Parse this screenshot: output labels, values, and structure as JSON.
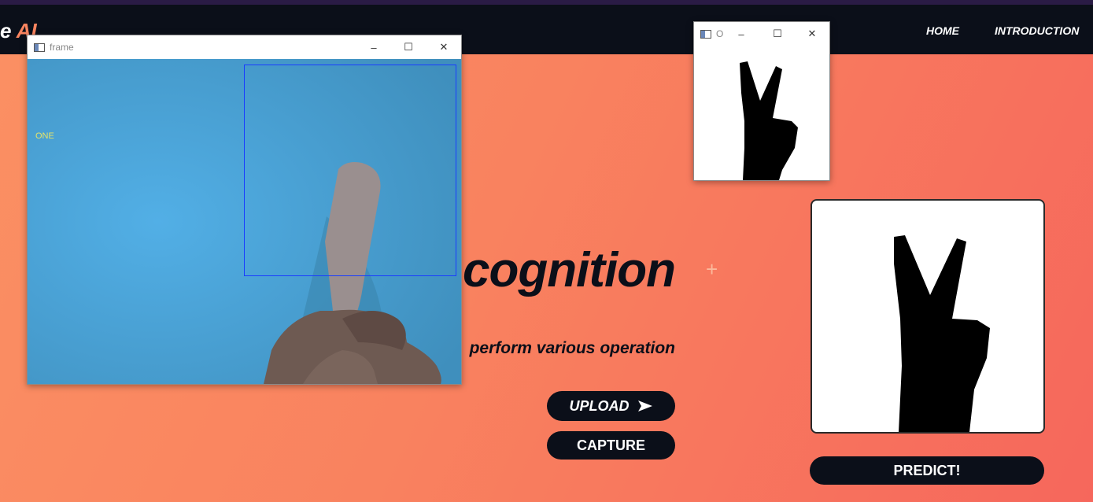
{
  "nav": {
    "brand_prefix": "e ",
    "brand_ai": "AI",
    "links": [
      "HOME",
      "INTRODUCTION"
    ]
  },
  "hero": {
    "title": "cognition",
    "subtitle": "perform various operation"
  },
  "buttons": {
    "upload": "UPLOAD",
    "capture": "CAPTURE",
    "predict": "PREDICT!"
  },
  "frame_window": {
    "title": "frame",
    "prediction": "ONE"
  },
  "threshold_window": {
    "title": "O"
  },
  "icons": {
    "upload": "send-arrow-icon",
    "minimize": "minimize-icon",
    "maximize": "maximize-icon",
    "close": "close-icon"
  },
  "colors": {
    "navbar": "#0b0f19",
    "accent": "#f9845f",
    "roi_box": "#1a3cff",
    "label_text": "#e4e36a",
    "camera_bg": "#4aa3d5"
  }
}
